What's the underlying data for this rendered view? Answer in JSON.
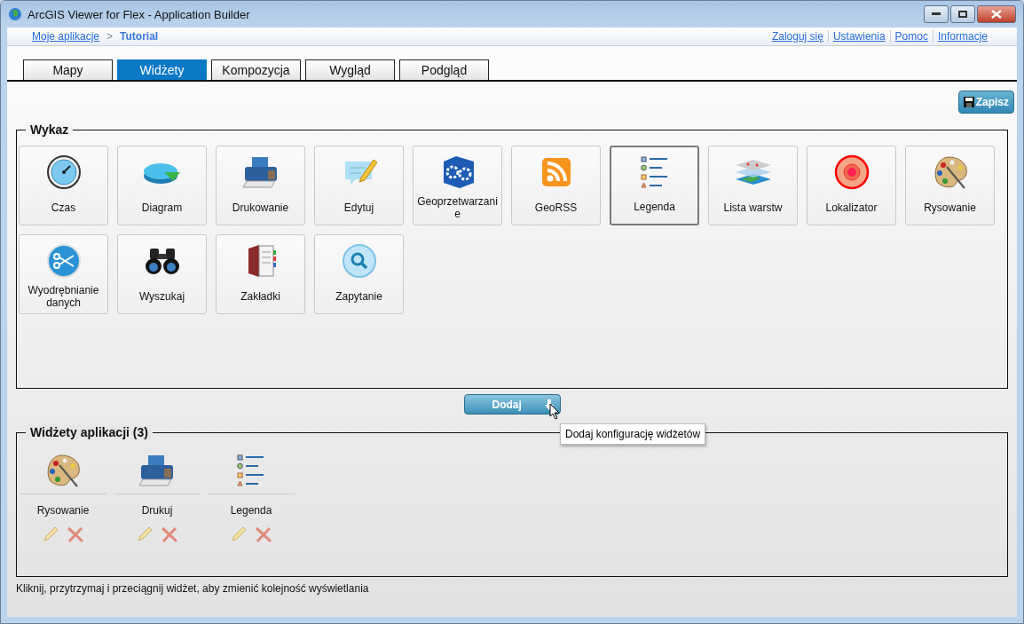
{
  "window": {
    "title": "ArcGIS Viewer for Flex - Application Builder"
  },
  "breadcrumb": {
    "link": "Moje aplikacje",
    "separator": ">",
    "current": "Tutorial"
  },
  "header_links": [
    "Zaloguj się",
    "Ustawienia",
    "Pomoc",
    "Informacje"
  ],
  "tabs": [
    {
      "label": "Mapy",
      "selected": false
    },
    {
      "label": "Widżety",
      "selected": true
    },
    {
      "label": "Kompozycja",
      "selected": false
    },
    {
      "label": "Wygląd",
      "selected": false
    },
    {
      "label": "Podgląd",
      "selected": false
    }
  ],
  "save_button": "Zapisz",
  "catalog": {
    "title": "Wykaz",
    "widgets": [
      {
        "label": "Czas",
        "selected": false
      },
      {
        "label": "Diagram",
        "selected": false
      },
      {
        "label": "Drukowanie",
        "selected": false
      },
      {
        "label": "Edytuj",
        "selected": false
      },
      {
        "label": "Geoprzetwarzanie",
        "selected": false
      },
      {
        "label": "GeoRSS",
        "selected": false
      },
      {
        "label": "Legenda",
        "selected": true
      },
      {
        "label": "Lista warstw",
        "selected": false
      },
      {
        "label": "Lokalizator",
        "selected": false
      },
      {
        "label": "Rysowanie",
        "selected": false
      },
      {
        "label": "Wyodrębnianie danych",
        "selected": false
      },
      {
        "label": "Wyszukaj",
        "selected": false
      },
      {
        "label": "Zakładki",
        "selected": false
      },
      {
        "label": "Zapytanie",
        "selected": false
      }
    ]
  },
  "add_button": "Dodaj",
  "tooltip": "Dodaj konfigurację widżetów",
  "app_widgets": {
    "title": "Widżety aplikacji (3)",
    "items": [
      {
        "label": "Rysowanie"
      },
      {
        "label": "Drukuj"
      },
      {
        "label": "Legenda"
      }
    ]
  },
  "hint": "Kliknij, przytrzymaj i przeciągnij widżet, aby zmienić kolejność wyświetlania"
}
